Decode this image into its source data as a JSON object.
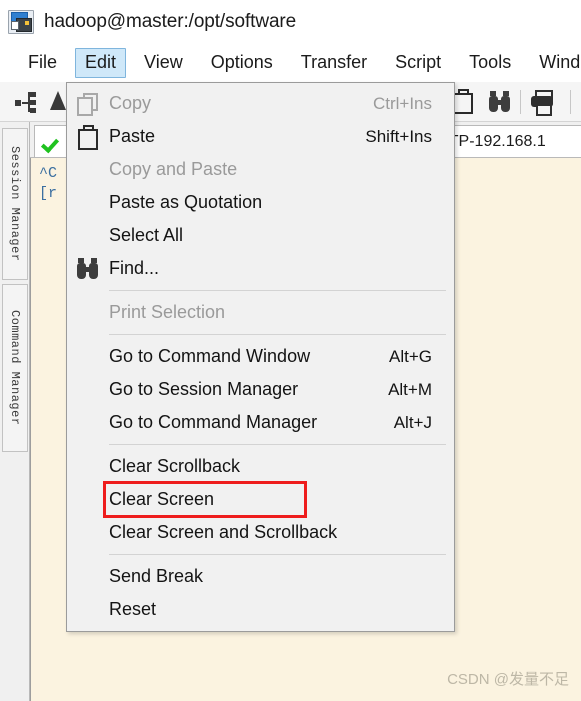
{
  "window": {
    "title": "hadoop@master:/opt/software",
    "icon": "securecrt-app-icon"
  },
  "menubar": {
    "items": [
      {
        "label": "File",
        "active": false
      },
      {
        "label": "Edit",
        "active": true
      },
      {
        "label": "View",
        "active": false
      },
      {
        "label": "Options",
        "active": false
      },
      {
        "label": "Transfer",
        "active": false
      },
      {
        "label": "Script",
        "active": false
      },
      {
        "label": "Tools",
        "active": false
      },
      {
        "label": "Wind",
        "active": false
      }
    ]
  },
  "toolbar": {
    "icons": [
      {
        "name": "connect-node-icon"
      },
      {
        "name": "font-size-icon"
      },
      {
        "name": "paste-icon"
      },
      {
        "name": "find-binoculars-icon"
      },
      {
        "name": "print-icon"
      }
    ]
  },
  "side_tabs": {
    "items": [
      {
        "label": "Session Manager"
      },
      {
        "label": "Command Manager"
      }
    ]
  },
  "session_tabs": {
    "active_indicator": "green-check",
    "ftp_tab_label": "FTP-192.168.1"
  },
  "terminal": {
    "lines": [
      "^C",
      "[r"
    ],
    "background": "#FBF3E0",
    "text_color": "#3B6FA0"
  },
  "watermark": {
    "text": "CSDN @发量不足"
  },
  "edit_menu": {
    "highlight_color": "#EE1C1C",
    "items": [
      {
        "type": "item",
        "label": "Copy",
        "accel": "Ctrl+Ins",
        "icon": "copy-icon",
        "disabled": true
      },
      {
        "type": "item",
        "label": "Paste",
        "accel": "Shift+Ins",
        "icon": "paste-icon",
        "disabled": false
      },
      {
        "type": "item",
        "label": "Copy and Paste",
        "accel": "",
        "icon": "",
        "disabled": true
      },
      {
        "type": "item",
        "label": "Paste as Quotation",
        "accel": "",
        "icon": "",
        "disabled": false
      },
      {
        "type": "item",
        "label": "Select All",
        "accel": "",
        "icon": "",
        "disabled": false
      },
      {
        "type": "item",
        "label": "Find...",
        "accel": "",
        "icon": "find-icon",
        "disabled": false
      },
      {
        "type": "separator"
      },
      {
        "type": "item",
        "label": "Print Selection",
        "accel": "",
        "icon": "",
        "disabled": true
      },
      {
        "type": "separator"
      },
      {
        "type": "item",
        "label": "Go to Command Window",
        "accel": "Alt+G",
        "icon": "",
        "disabled": false
      },
      {
        "type": "item",
        "label": "Go to Session Manager",
        "accel": "Alt+M",
        "icon": "",
        "disabled": false
      },
      {
        "type": "item",
        "label": "Go to Command Manager",
        "accel": "Alt+J",
        "icon": "",
        "disabled": false
      },
      {
        "type": "separator"
      },
      {
        "type": "item",
        "label": "Clear Scrollback",
        "accel": "",
        "icon": "",
        "disabled": false
      },
      {
        "type": "item",
        "label": "Clear Screen",
        "accel": "",
        "icon": "",
        "disabled": false,
        "highlighted": true
      },
      {
        "type": "item",
        "label": "Clear Screen and Scrollback",
        "accel": "",
        "icon": "",
        "disabled": false
      },
      {
        "type": "separator"
      },
      {
        "type": "item",
        "label": "Send Break",
        "accel": "",
        "icon": "",
        "disabled": false
      },
      {
        "type": "item",
        "label": "Reset",
        "accel": "",
        "icon": "",
        "disabled": false
      }
    ]
  }
}
